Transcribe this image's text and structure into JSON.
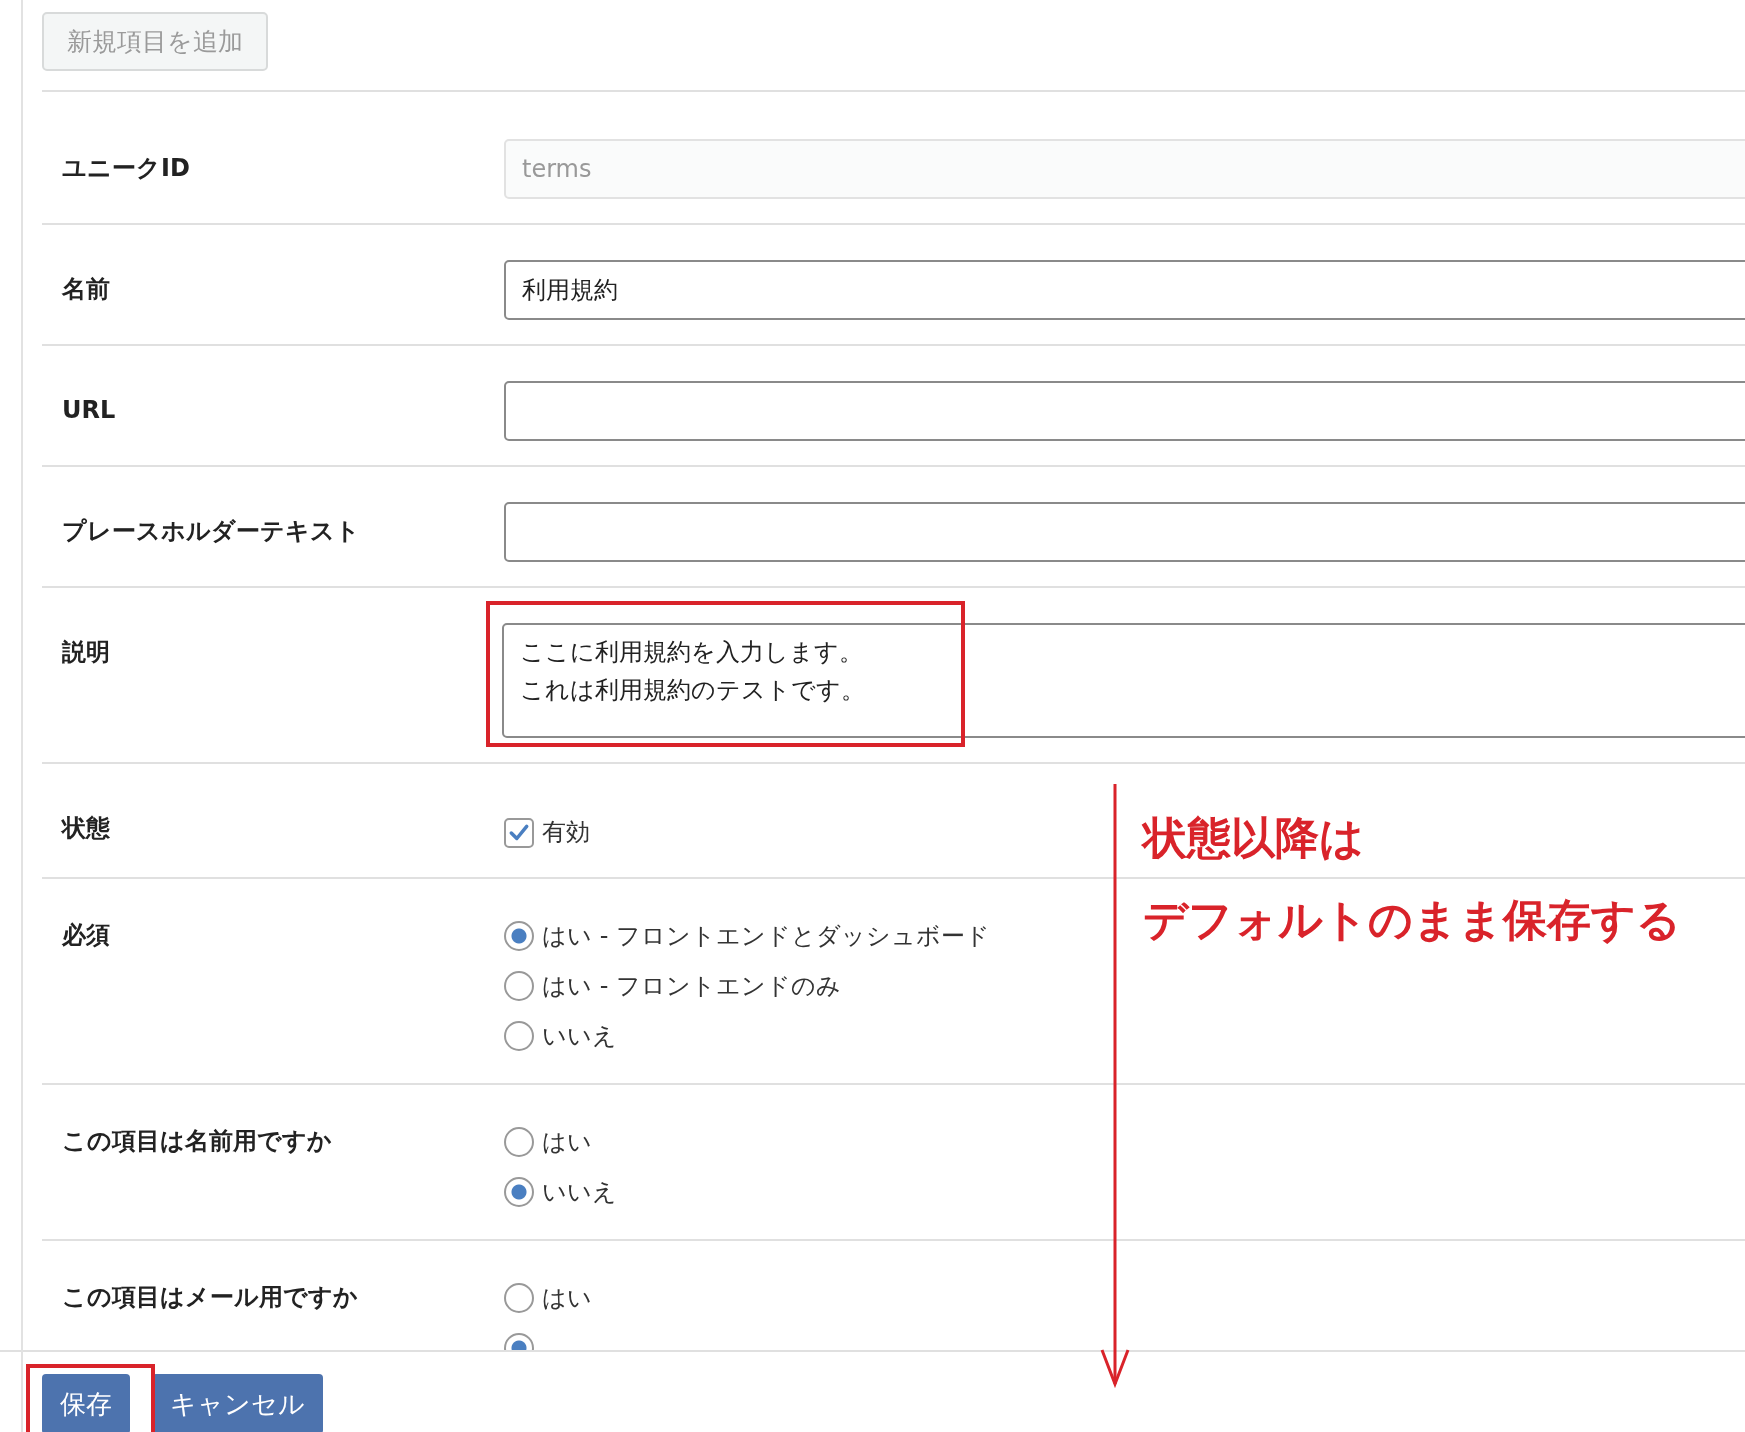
{
  "add_button": {
    "label": "新規項目を追加",
    "disabled": true
  },
  "fields": [
    {
      "kind": "text",
      "label": "ユニークID",
      "value": "terms",
      "disabled": true
    },
    {
      "kind": "text",
      "label": "名前",
      "value": "利用規約",
      "disabled": false
    },
    {
      "kind": "text",
      "label": "URL",
      "disabled": false
    },
    {
      "kind": "text",
      "label": "プレースホルダーテキスト",
      "disabled": false
    },
    {
      "kind": "textarea",
      "label": "説明",
      "lines": [
        "ここに利用規約を入力します。",
        "これは利用規約のテストです。"
      ]
    },
    {
      "kind": "checkbox",
      "label": "状態",
      "option": "有効",
      "checked": true
    },
    {
      "kind": "radio",
      "label": "必須",
      "options": [
        {
          "label": "はい - フロントエンドとダッシュボード",
          "selected": true
        },
        {
          "label": "はい - フロントエンドのみ",
          "selected": false
        },
        {
          "label": "いいえ",
          "selected": false
        }
      ]
    },
    {
      "kind": "radio",
      "label": "この項目は名前用ですか",
      "options": [
        {
          "label": "はい",
          "selected": false
        },
        {
          "label": "いいえ",
          "selected": true
        }
      ]
    },
    {
      "kind": "radio",
      "label": "この項目はメール用ですか",
      "options": [
        {
          "label": "はい",
          "selected": false
        },
        {
          "selected": true
        }
      ]
    }
  ],
  "buttons": [
    {
      "label": "保存",
      "kind": "primary"
    },
    {
      "label": "キャンセル",
      "kind": "primary"
    }
  ],
  "annotation": {
    "note_lines": [
      "状態以降は",
      "デフォルトのまま保存する"
    ]
  }
}
